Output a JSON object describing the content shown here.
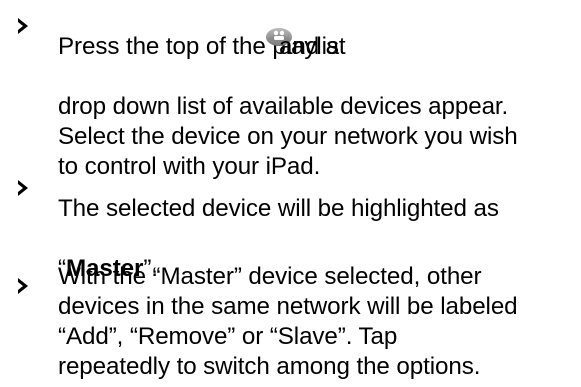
{
  "bullets": [
    {
      "line1_before": "Press the top of the playlist",
      "line1_after": "and a",
      "rest": "drop down list of available devices appear.\nSelect the device on your network you wish\nto control with your iPad."
    },
    {
      "line1": "The selected device will be highlighted as",
      "line2_open": "“",
      "line2_bold": "Master",
      "line2_close": "”."
    },
    {
      "text": "With the “Master” device selected, other\ndevices in the same network will be labeled\n“Add”, “Remove” or “Slave”.  Tap\nrepeatedly to switch among the options."
    }
  ],
  "icons": {
    "bullet": "right-arrow-bullet-icon",
    "playlist": "playlist-device-icon"
  }
}
